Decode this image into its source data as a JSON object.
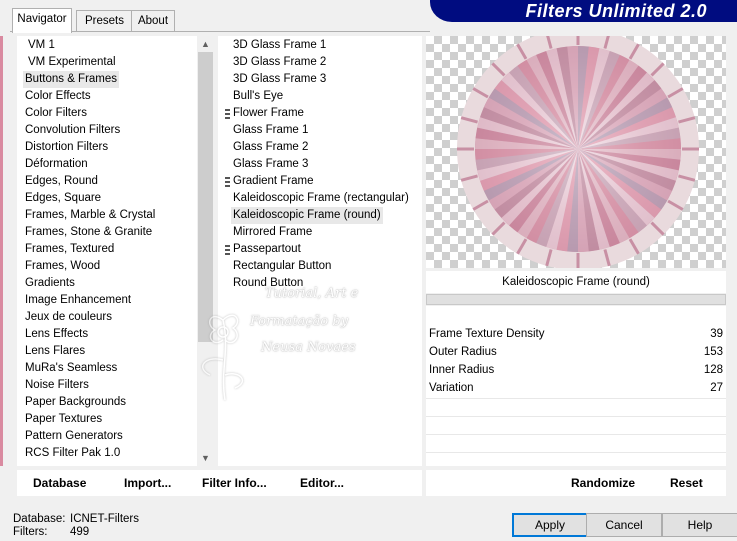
{
  "tabs": [
    {
      "label": "Navigator",
      "active": true
    },
    {
      "label": "Presets",
      "active": false
    },
    {
      "label": "About",
      "active": false
    }
  ],
  "banner": {
    "title": "Filters Unlimited 2.0",
    "color": "#000c80"
  },
  "categories": {
    "selected": "Buttons & Frames",
    "items": [
      "VM 1",
      "VM Experimental",
      "Buttons & Frames",
      "Color Effects",
      "Color Filters",
      "Convolution Filters",
      "Distortion Filters",
      "Déformation",
      "Edges, Round",
      "Edges, Square",
      "Frames, Marble & Crystal",
      "Frames, Stone & Granite",
      "Frames, Textured",
      "Frames, Wood",
      "Gradients",
      "Image Enhancement",
      "Jeux de couleurs",
      "Lens Effects",
      "Lens Flares",
      "MuRa's Seamless",
      "Noise Filters",
      "Paper Backgrounds",
      "Paper Textures",
      "Pattern Generators",
      "RCS Filter Pak 1.0"
    ]
  },
  "filters": {
    "selected": "Kaleidoscopic Frame (round)",
    "items": [
      {
        "label": "3D Glass Frame 1",
        "grip": false
      },
      {
        "label": "3D Glass Frame 2",
        "grip": false
      },
      {
        "label": "3D Glass Frame 3",
        "grip": false
      },
      {
        "label": "Bull's Eye",
        "grip": false
      },
      {
        "label": "Flower Frame",
        "grip": true
      },
      {
        "label": "Glass Frame 1",
        "grip": false
      },
      {
        "label": "Glass Frame 2",
        "grip": false
      },
      {
        "label": "Glass Frame 3",
        "grip": false
      },
      {
        "label": "Gradient Frame",
        "grip": true
      },
      {
        "label": "Kaleidoscopic Frame (rectangular)",
        "grip": false
      },
      {
        "label": "Kaleidoscopic Frame (round)",
        "grip": false
      },
      {
        "label": "Mirrored Frame",
        "grip": false
      },
      {
        "label": "Passepartout",
        "grip": true
      },
      {
        "label": "Rectangular Button",
        "grip": false
      },
      {
        "label": "Round Button",
        "grip": false
      }
    ]
  },
  "toolbar": {
    "database": "Database",
    "import": "Import...",
    "filter_info": "Filter Info...",
    "editor": "Editor..."
  },
  "preview": {
    "filter_name": "Kaleidoscopic Frame (round)"
  },
  "params": [
    {
      "name": "Frame Texture Density",
      "value": "39"
    },
    {
      "name": "Outer Radius",
      "value": "153"
    },
    {
      "name": "Inner Radius",
      "value": "128"
    },
    {
      "name": "Variation",
      "value": "27"
    }
  ],
  "actions": {
    "randomize": "Randomize",
    "reset": "Reset"
  },
  "status": {
    "database_label": "Database:",
    "database_value": "ICNET-Filters",
    "filters_label": "Filters:",
    "filters_value": "499"
  },
  "dialog": {
    "apply": "Apply",
    "cancel": "Cancel",
    "help": "Help"
  },
  "watermark": {
    "line1": "Tutorial, Art e",
    "line2": "Formatação by",
    "line3": "Neusa Novaes"
  }
}
